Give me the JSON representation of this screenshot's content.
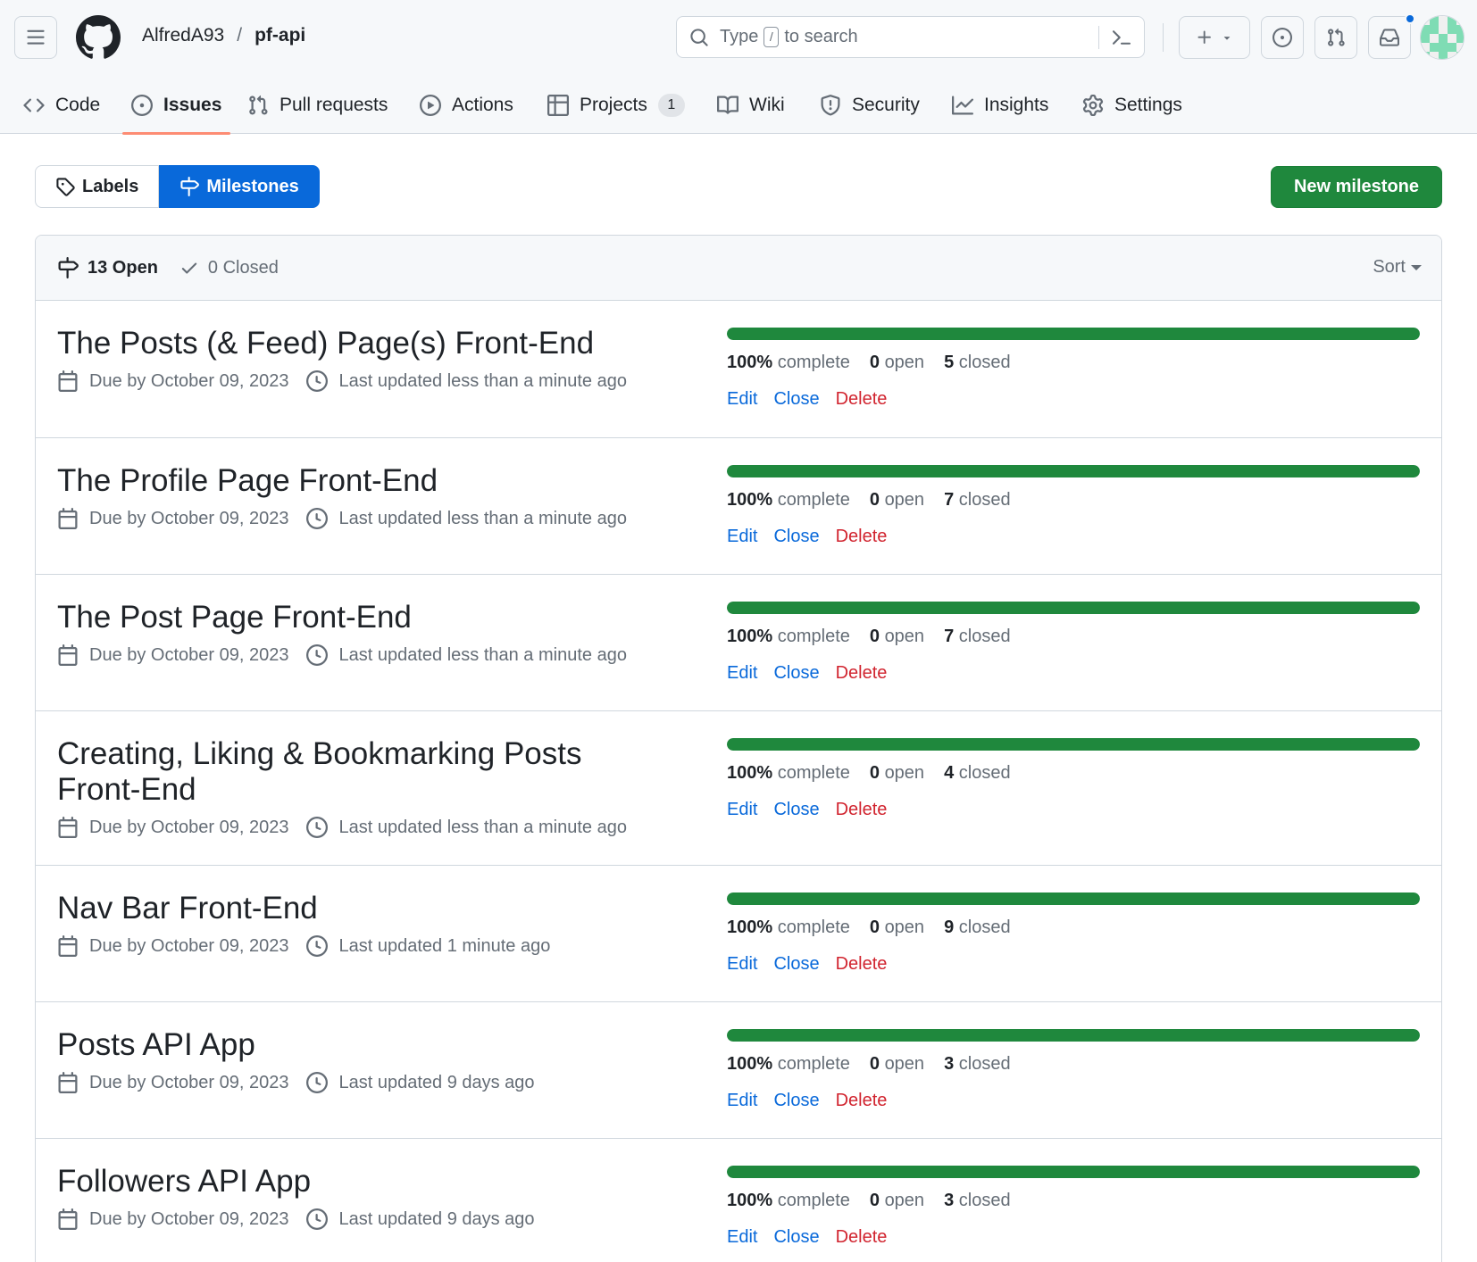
{
  "header": {
    "owner": "AlfredA93",
    "separator": "/",
    "repo": "pf-api",
    "search_prefix": "Type",
    "search_key": "/",
    "search_suffix": "to search"
  },
  "nav": {
    "tabs": [
      {
        "label": "Code",
        "icon": "code-icon"
      },
      {
        "label": "Issues",
        "icon": "issue-opened-icon"
      },
      {
        "label": "Pull requests",
        "icon": "git-pull-request-icon"
      },
      {
        "label": "Actions",
        "icon": "play-icon"
      },
      {
        "label": "Projects",
        "icon": "table-icon",
        "counter": "1"
      },
      {
        "label": "Wiki",
        "icon": "book-icon"
      },
      {
        "label": "Security",
        "icon": "shield-icon"
      },
      {
        "label": "Insights",
        "icon": "graph-icon"
      },
      {
        "label": "Settings",
        "icon": "gear-icon"
      }
    ]
  },
  "subnav": {
    "labels": "Labels",
    "milestones": "Milestones",
    "new_milestone": "New milestone"
  },
  "list": {
    "open_label": "13 Open",
    "closed_label": "0 Closed",
    "sort_label": "Sort",
    "milestones": [
      {
        "title": "The Posts (& Feed) Page(s) Front-End",
        "due": "Due by October 09, 2023",
        "updated": "Last updated less than a minute ago",
        "percent": "100%",
        "complete_label": "complete",
        "open_count": "0",
        "open_label": "open",
        "closed_count": "5",
        "closed_label": "closed",
        "progress": 1.0,
        "edit": "Edit",
        "close": "Close",
        "delete": "Delete"
      },
      {
        "title": "The Profile Page Front-End",
        "due": "Due by October 09, 2023",
        "updated": "Last updated less than a minute ago",
        "percent": "100%",
        "complete_label": "complete",
        "open_count": "0",
        "open_label": "open",
        "closed_count": "7",
        "closed_label": "closed",
        "progress": 1.0,
        "edit": "Edit",
        "close": "Close",
        "delete": "Delete"
      },
      {
        "title": "The Post Page Front-End",
        "due": "Due by October 09, 2023",
        "updated": "Last updated less than a minute ago",
        "percent": "100%",
        "complete_label": "complete",
        "open_count": "0",
        "open_label": "open",
        "closed_count": "7",
        "closed_label": "closed",
        "progress": 1.0,
        "edit": "Edit",
        "close": "Close",
        "delete": "Delete"
      },
      {
        "title": "Creating, Liking & Bookmarking Posts Front-End",
        "due": "Due by October 09, 2023",
        "updated": "Last updated less than a minute ago",
        "percent": "100%",
        "complete_label": "complete",
        "open_count": "0",
        "open_label": "open",
        "closed_count": "4",
        "closed_label": "closed",
        "progress": 1.0,
        "edit": "Edit",
        "close": "Close",
        "delete": "Delete"
      },
      {
        "title": "Nav Bar Front-End",
        "due": "Due by October 09, 2023",
        "updated": "Last updated 1 minute ago",
        "percent": "100%",
        "complete_label": "complete",
        "open_count": "0",
        "open_label": "open",
        "closed_count": "9",
        "closed_label": "closed",
        "progress": 1.0,
        "edit": "Edit",
        "close": "Close",
        "delete": "Delete"
      },
      {
        "title": "Posts API App",
        "due": "Due by October 09, 2023",
        "updated": "Last updated 9 days ago",
        "percent": "100%",
        "complete_label": "complete",
        "open_count": "0",
        "open_label": "open",
        "closed_count": "3",
        "closed_label": "closed",
        "progress": 1.0,
        "edit": "Edit",
        "close": "Close",
        "delete": "Delete"
      },
      {
        "title": "Followers API App",
        "due": "Due by October 09, 2023",
        "updated": "Last updated 9 days ago",
        "percent": "100%",
        "complete_label": "complete",
        "open_count": "0",
        "open_label": "open",
        "closed_count": "3",
        "closed_label": "closed",
        "progress": 1.0,
        "edit": "Edit",
        "close": "Close",
        "delete": "Delete"
      }
    ]
  },
  "colors": {
    "accent_blue": "#0969da",
    "success_green": "#1f883d",
    "danger_red": "#d1242f",
    "tab_underline": "#fd8c73"
  }
}
